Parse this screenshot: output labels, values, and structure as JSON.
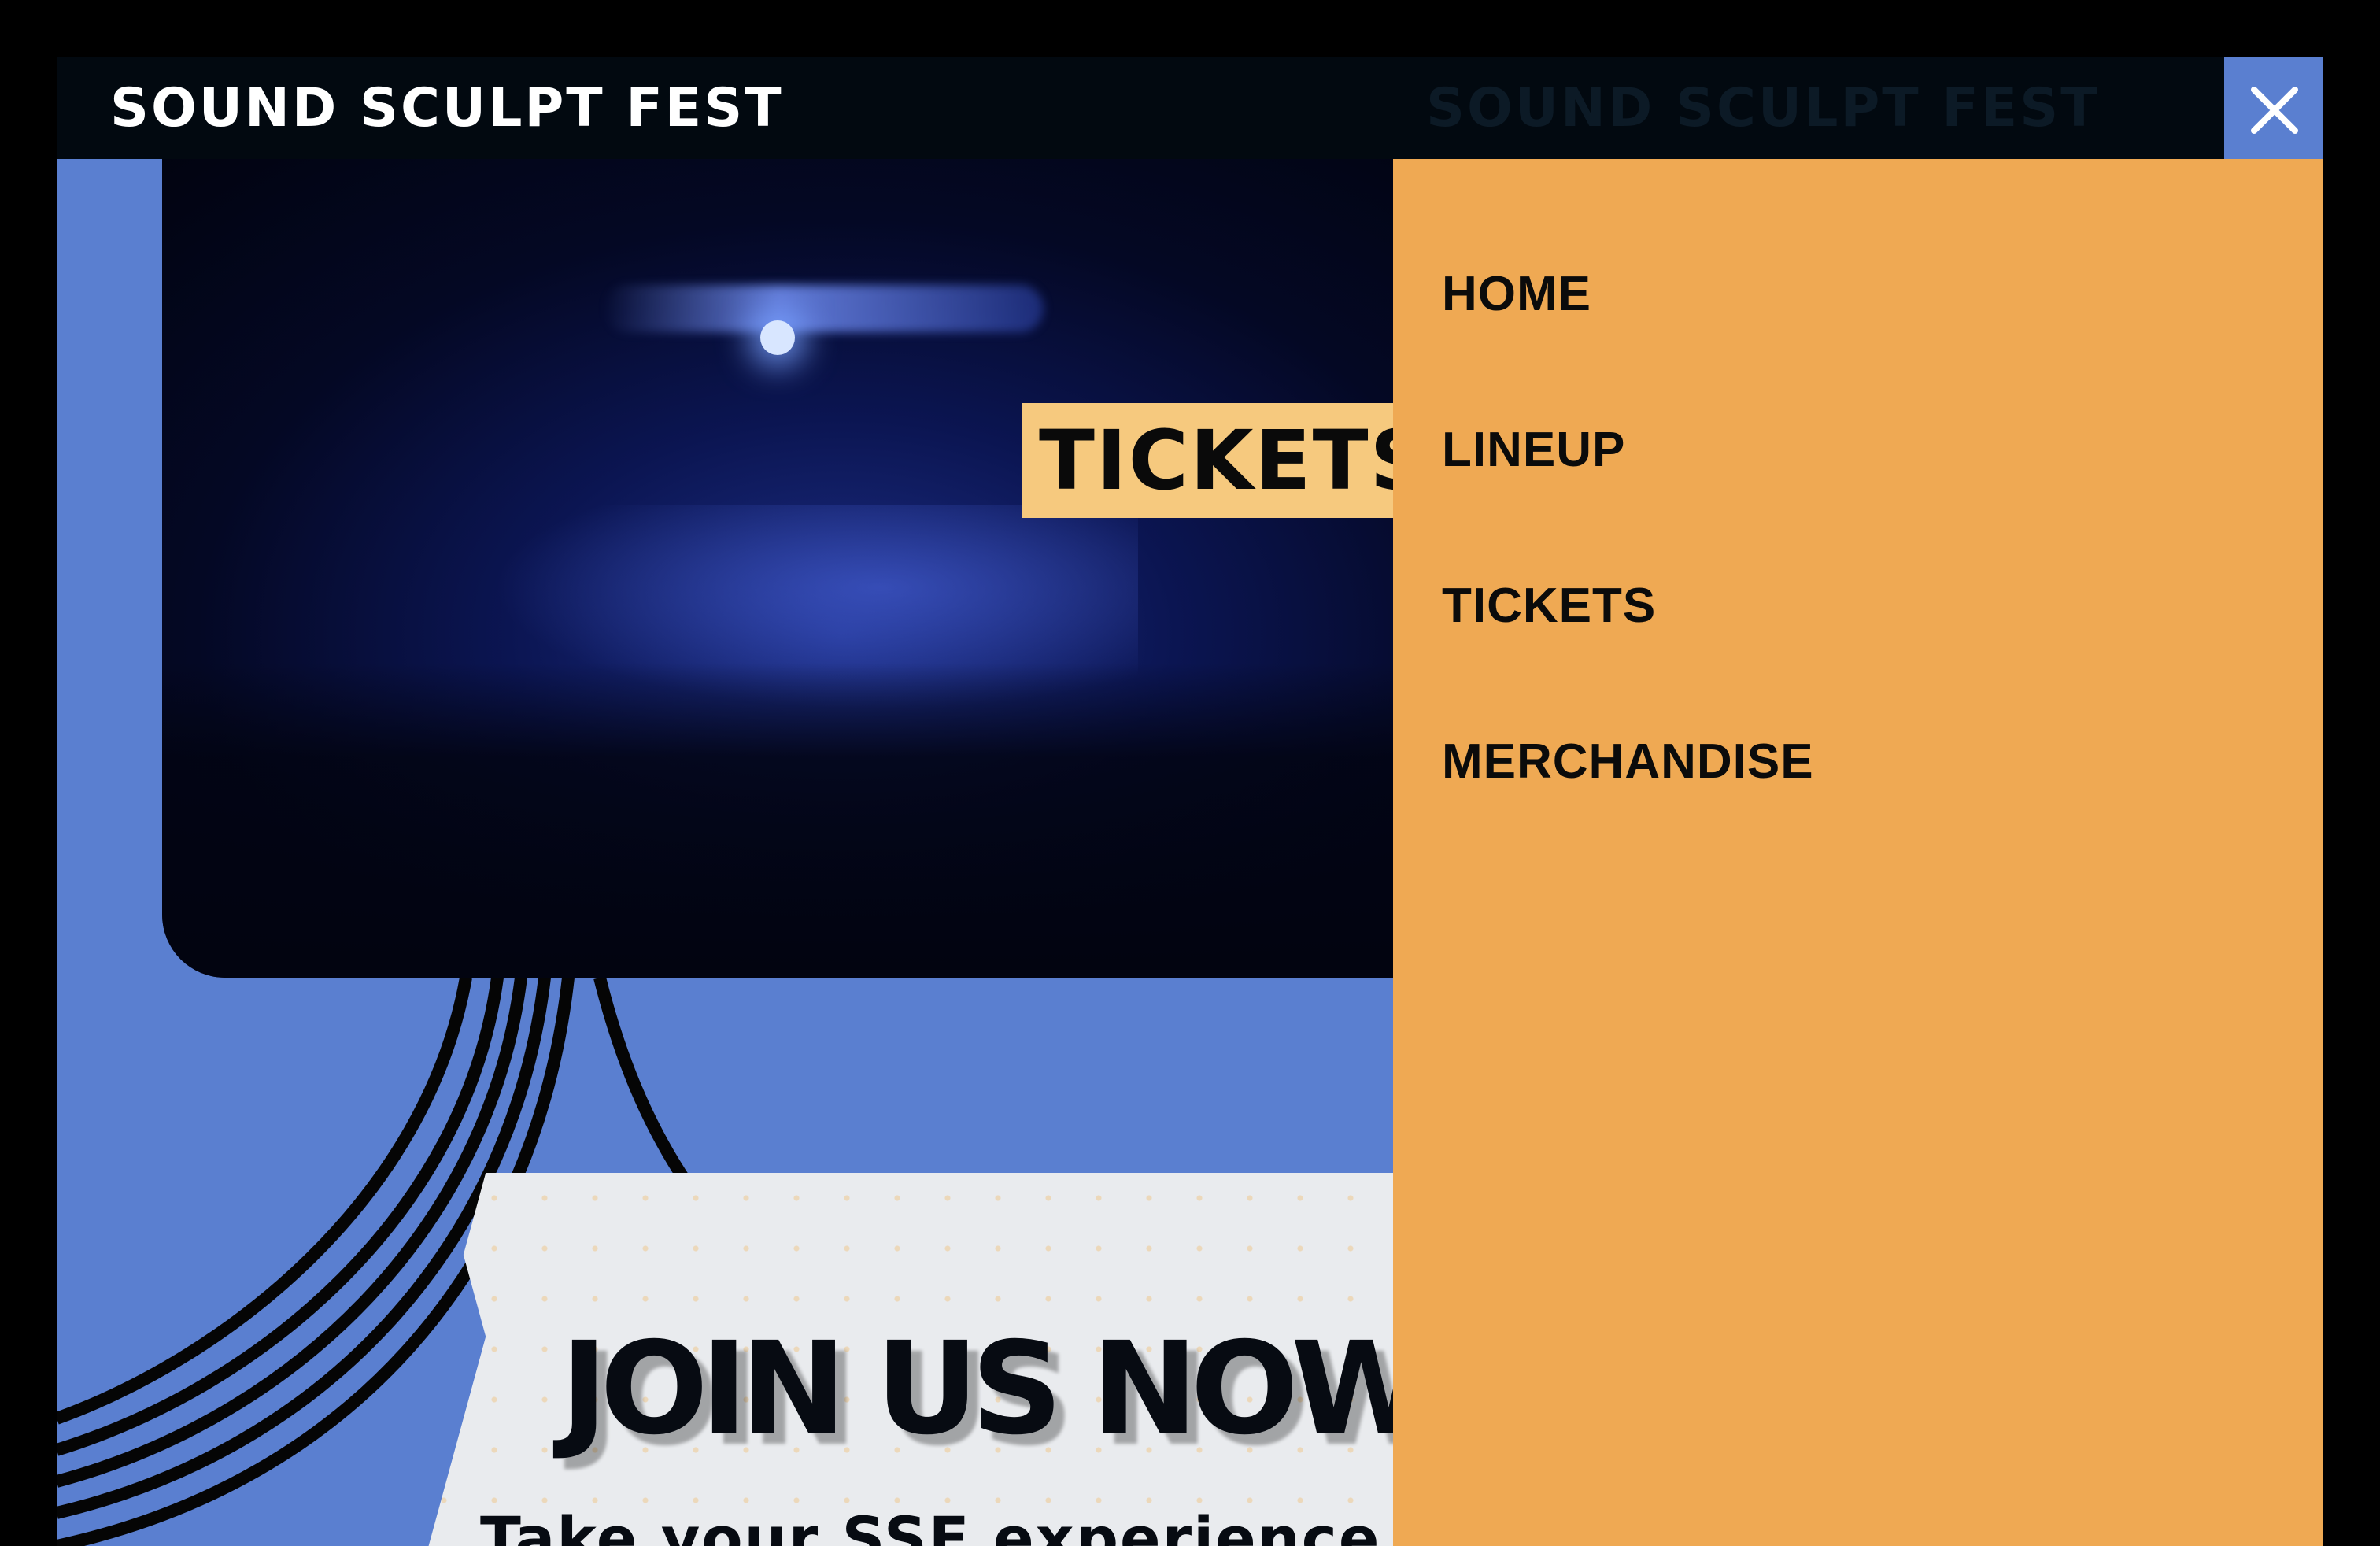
{
  "header": {
    "logo_text": "SOUND SCULPT FEST",
    "logo_ghost_text": "SOUND SCULPT FEST",
    "close_icon": "close-icon"
  },
  "hero": {
    "tickets_badge": "TICKETS",
    "video_icon": "concert-video"
  },
  "promo": {
    "headline": "JOIN US NOW!",
    "subheadline": "Take your SSF experience"
  },
  "nav_menu": {
    "items": [
      {
        "label": "HOME"
      },
      {
        "label": "LINEUP"
      },
      {
        "label": "TICKETS"
      },
      {
        "label": "MERCHANDISE"
      }
    ],
    "background": "#efa953"
  },
  "colors": {
    "page_bg": "#000000",
    "hero_blue": "#5a7fd0",
    "badge": "#f6c97e",
    "menu": "#efa953"
  }
}
